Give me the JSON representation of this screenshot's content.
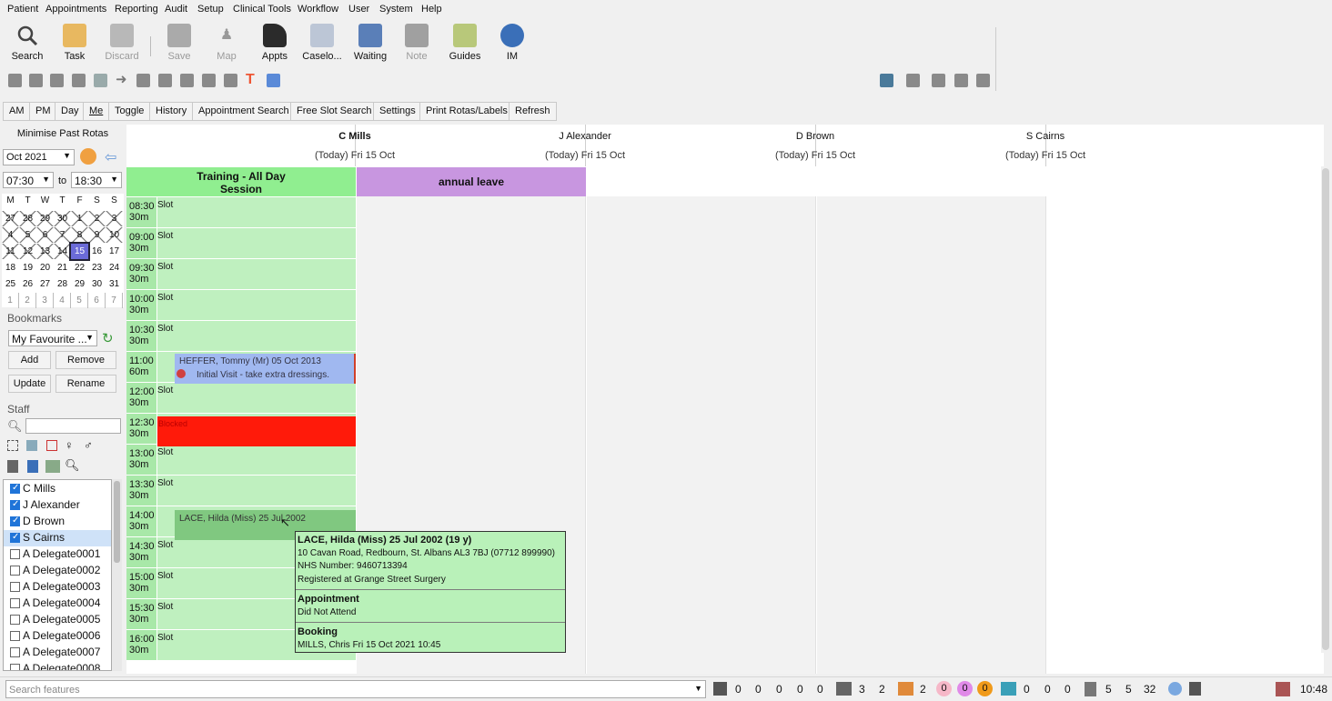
{
  "menu": [
    "Patient",
    "Appointments",
    "Reporting",
    "Audit",
    "Setup",
    "Clinical Tools",
    "Workflow",
    "User",
    "System",
    "Help"
  ],
  "toolbar": [
    {
      "label": "Search",
      "icon": "search-icon",
      "enabled": true
    },
    {
      "label": "Task",
      "icon": "task-icon",
      "enabled": true
    },
    {
      "label": "Discard",
      "icon": "trash-icon",
      "enabled": false
    },
    {
      "label": "Save",
      "icon": "save-icon",
      "enabled": false
    },
    {
      "label": "Map",
      "icon": "map-icon",
      "enabled": false
    },
    {
      "label": "Appts",
      "icon": "appointments-icon",
      "enabled": true
    },
    {
      "label": "Caselo...",
      "icon": "caseload-icon",
      "enabled": true
    },
    {
      "label": "Waiting",
      "icon": "waiting-icon",
      "enabled": true
    },
    {
      "label": "Note",
      "icon": "note-icon",
      "enabled": false
    },
    {
      "label": "Guides",
      "icon": "guides-icon",
      "enabled": true
    },
    {
      "label": "IM",
      "icon": "im-icon",
      "enabled": true
    }
  ],
  "secondary_buttons": [
    "AM",
    "PM",
    "Day",
    "Me",
    "Toggle",
    "History",
    "Appointment Search",
    "Free Slot Search",
    "Settings",
    "Print Rotas/Labels",
    "Refresh"
  ],
  "left": {
    "minimise": "Minimise Past Rotas",
    "month": "Oct 2021",
    "time_from": "07:30",
    "to": "to",
    "time_to": "18:30",
    "weekdays": [
      "M",
      "T",
      "W",
      "T",
      "F",
      "S",
      "S"
    ],
    "weeks": [
      [
        "27",
        "28",
        "29",
        "30",
        "1",
        "2",
        "3"
      ],
      [
        "4",
        "5",
        "6",
        "7",
        "8",
        "9",
        "10"
      ],
      [
        "11",
        "12",
        "13",
        "14",
        "15",
        "16",
        "17"
      ],
      [
        "18",
        "19",
        "20",
        "21",
        "22",
        "23",
        "24"
      ],
      [
        "25",
        "26",
        "27",
        "28",
        "29",
        "30",
        "31"
      ],
      [
        "1",
        "2",
        "3",
        "4",
        "5",
        "6",
        "7"
      ]
    ],
    "today": "15",
    "bookmarks_label": "Bookmarks",
    "bookmark_select": "My Favourite ...",
    "bm_buttons": [
      "Add",
      "Remove",
      "Update",
      "Rename"
    ],
    "staff_label": "Staff",
    "staff": [
      {
        "name": "C Mills",
        "checked": true
      },
      {
        "name": "J Alexander",
        "checked": true
      },
      {
        "name": "D Brown",
        "checked": true
      },
      {
        "name": "S Cairns",
        "checked": true
      },
      {
        "name": "A Delegate0001",
        "checked": false
      },
      {
        "name": "A Delegate0002",
        "checked": false
      },
      {
        "name": "A Delegate0003",
        "checked": false
      },
      {
        "name": "A Delegate0004",
        "checked": false
      },
      {
        "name": "A Delegate0005",
        "checked": false
      },
      {
        "name": "A Delegate0006",
        "checked": false
      },
      {
        "name": "A Delegate0007",
        "checked": false
      },
      {
        "name": "A Delegate0008",
        "checked": false
      }
    ]
  },
  "columns": [
    {
      "name": "C Mills",
      "date": "(Today) Fri 15 Oct"
    },
    {
      "name": "J Alexander",
      "date": "(Today) Fri 15 Oct"
    },
    {
      "name": "D Brown",
      "date": "(Today) Fri 15 Oct"
    },
    {
      "name": "S Cairns",
      "date": "(Today) Fri 15 Oct"
    }
  ],
  "training": "Training - All Day\nSession",
  "training_l1": "Training - All Day",
  "training_l2": "Session",
  "annual_leave": "annual leave",
  "rows": [
    {
      "time": "08:30",
      "dur": "30m",
      "label": "Slot"
    },
    {
      "time": "09:00",
      "dur": "30m",
      "label": "Slot"
    },
    {
      "time": "09:30",
      "dur": "30m",
      "label": "Slot"
    },
    {
      "time": "10:00",
      "dur": "30m",
      "label": "Slot"
    },
    {
      "time": "10:30",
      "dur": "30m",
      "label": "Slot"
    },
    {
      "time": "11:00",
      "dur": "60m",
      "label": ""
    },
    {
      "time": "12:00",
      "dur": "30m",
      "label": "Slot"
    },
    {
      "time": "12:30",
      "dur": "30m",
      "label": "Blocked"
    },
    {
      "time": "13:00",
      "dur": "30m",
      "label": "Slot"
    },
    {
      "time": "13:30",
      "dur": "30m",
      "label": "Slot"
    },
    {
      "time": "14:00",
      "dur": "30m",
      "label": ""
    },
    {
      "time": "14:30",
      "dur": "30m",
      "label": "Slot"
    },
    {
      "time": "15:00",
      "dur": "30m",
      "label": "Slot"
    },
    {
      "time": "15:30",
      "dur": "30m",
      "label": "Slot"
    },
    {
      "time": "16:00",
      "dur": "30m",
      "label": "Slot"
    }
  ],
  "appt1": {
    "line1": "HEFFER, Tommy (Mr) 05 Oct 2013",
    "line2": "Initial Visit - take extra dressings."
  },
  "appt2": {
    "line1": "LACE, Hilda (Miss) 25 Jul 2002"
  },
  "tooltip": {
    "title": "LACE, Hilda (Miss) 25 Jul 2002 (19 y)",
    "address": "10 Cavan Road, Redbourn, St. Albans AL3 7BJ (07712 899990)",
    "nhs": "NHS Number: 9460713394",
    "registered": "Registered at Grange Street Surgery",
    "appt_h": "Appointment",
    "appt_v": "Did Not Attend",
    "book_h": "Booking",
    "book_v": "MILLS, Chris Fri 15 Oct 2021 10:45"
  },
  "status": {
    "search_placeholder": "Search features",
    "g1": [
      "0",
      "0",
      "0",
      "0",
      "0"
    ],
    "g2": [
      "3",
      "2"
    ],
    "g3": [
      "2",
      "0",
      "0",
      "0"
    ],
    "g4": [
      "0",
      "0",
      "0"
    ],
    "g5": [
      "5",
      "5",
      "32"
    ],
    "clock": "10:48"
  },
  "colors": {
    "training": "#90ee90",
    "leave": "#c896e0",
    "blocked": "#ff1a0a",
    "appt": "#a0b8f0",
    "appt2": "#80c880"
  }
}
